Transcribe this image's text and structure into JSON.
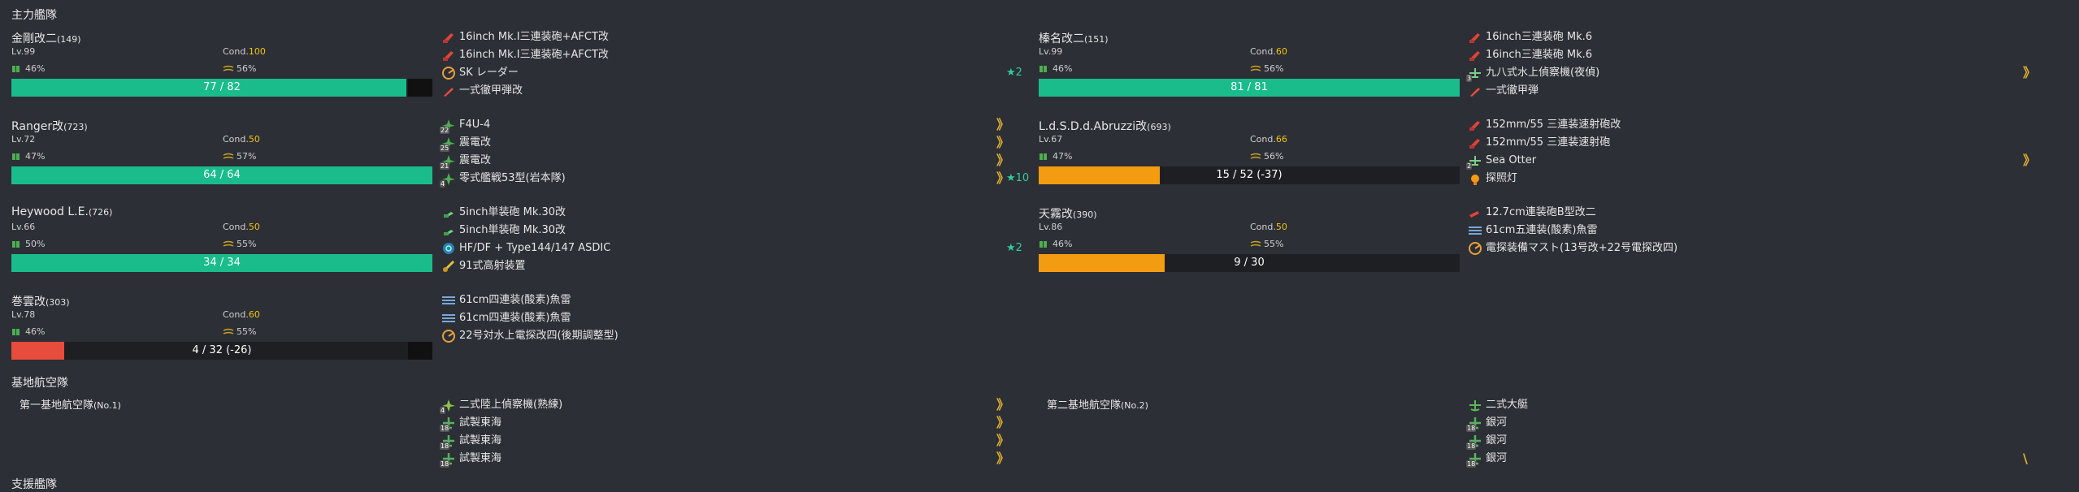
{
  "sections": {
    "main_fleet": "主力艦隊",
    "base_air": "基地航空隊",
    "support": "支援艦隊"
  },
  "colors": {
    "hp_green": "#1abc8c",
    "hp_orange": "#f39c12",
    "hp_red": "#e74c3c",
    "cond_yellow": "#f1c40f",
    "star": "#2ecc9a"
  },
  "ships": [
    {
      "name": "金剛改二",
      "id": "(149)",
      "lv": "Lv.99",
      "cond_label": "Cond.",
      "cond": "100",
      "fuel": "46%",
      "ammo": "56%",
      "hp": "77 / 82",
      "hp_frac": 0.939,
      "hp_color": "green",
      "equips": [
        {
          "icon": "gun-red-icon",
          "name": "16inch Mk.I三連装砲+AFCT改"
        },
        {
          "icon": "gun-red-icon",
          "name": "16inch Mk.I三連装砲+AFCT改"
        },
        {
          "icon": "radar-icon",
          "name": "SK レーダー",
          "star": "★2"
        },
        {
          "icon": "shell-icon",
          "name": "一式徹甲弾改"
        }
      ]
    },
    {
      "name": "榛名改二",
      "id": "(151)",
      "lv": "Lv.99",
      "cond_label": "Cond.",
      "cond": "60",
      "fuel": "46%",
      "ammo": "56%",
      "hp": "81 / 81",
      "hp_frac": 1.0,
      "hp_color": "green",
      "equips": [
        {
          "icon": "gun-red-icon",
          "name": "16inch三連装砲 Mk.6"
        },
        {
          "icon": "gun-red-icon",
          "name": "16inch三連装砲 Mk.6"
        },
        {
          "icon": "seaplane-icon",
          "name": "九八式水上偵察機(夜偵)",
          "prof": "3",
          "chev": "》"
        },
        {
          "icon": "shell-icon",
          "name": "一式徹甲弾"
        }
      ]
    },
    {
      "name": "Ranger改",
      "id": "(723)",
      "lv": "Lv.72",
      "cond_label": "Cond.",
      "cond": "50",
      "fuel": "47%",
      "ammo": "57%",
      "hp": "64 / 64",
      "hp_frac": 1.0,
      "hp_color": "green",
      "equips": [
        {
          "icon": "fighter-icon",
          "name": "F4U-4",
          "prof": "22",
          "chev": "》"
        },
        {
          "icon": "fighter-icon",
          "name": "震電改",
          "prof": "25",
          "chev": "》"
        },
        {
          "icon": "fighter-icon",
          "name": "震電改",
          "prof": "21",
          "chev": "》"
        },
        {
          "icon": "fighter-icon",
          "name": "零式艦戦53型(岩本隊)",
          "prof": "4",
          "chev": "》",
          "star": "★10"
        }
      ]
    },
    {
      "name": "L.d.S.D.d.Abruzzi改",
      "id": "(693)",
      "lv": "Lv.67",
      "cond_label": "Cond.",
      "cond": "66",
      "fuel": "47%",
      "ammo": "56%",
      "hp": "15 / 52 (-37)",
      "hp_frac": 0.288,
      "hp_color": "orange",
      "equips": [
        {
          "icon": "gun-red-icon",
          "name": "152mm/55 三連装速射砲改"
        },
        {
          "icon": "gun-red-icon",
          "name": "152mm/55 三連装速射砲"
        },
        {
          "icon": "seaplane-icon",
          "name": "Sea Otter",
          "prof": "2",
          "chev": "》"
        },
        {
          "icon": "searchlight-icon",
          "name": "探照灯"
        }
      ]
    },
    {
      "name": "Heywood L.E.",
      "id": "(726)",
      "lv": "Lv.66",
      "cond_label": "Cond.",
      "cond": "50",
      "fuel": "50%",
      "ammo": "55%",
      "hp": "34 / 34",
      "hp_frac": 1.0,
      "hp_color": "green",
      "equips": [
        {
          "icon": "gun-green-icon",
          "name": "5inch単装砲 Mk.30改"
        },
        {
          "icon": "gun-green-icon",
          "name": "5inch単装砲 Mk.30改"
        },
        {
          "icon": "sonar-icon",
          "name": "HF/DF + Type144/147 ASDIC",
          "star": "★2"
        },
        {
          "icon": "aa-gun-icon",
          "name": "91式高射装置"
        }
      ]
    },
    {
      "name": "天霧改",
      "id": "(390)",
      "lv": "Lv.86",
      "cond_label": "Cond.",
      "cond": "50",
      "fuel": "46%",
      "ammo": "55%",
      "hp": "9 / 30",
      "hp_frac": 0.3,
      "hp_color": "orange",
      "equips": [
        {
          "icon": "gun-red-small-icon",
          "name": "12.7cm連装砲B型改二"
        },
        {
          "icon": "torpedo-icon",
          "name": "61cm五連装(酸素)魚雷"
        },
        {
          "icon": "radar-icon",
          "name": "電探装備マスト(13号改+22号電探改四)"
        }
      ]
    },
    {
      "name": "巻雲改",
      "id": "(303)",
      "lv": "Lv.78",
      "cond_label": "Cond.",
      "cond": "60",
      "fuel": "46%",
      "ammo": "55%",
      "hp": "4 / 32 (-26)",
      "hp_frac": 0.125,
      "hp_color": "red",
      "equips": [
        {
          "icon": "torpedo-icon",
          "name": "61cm四連装(酸素)魚雷"
        },
        {
          "icon": "torpedo-icon",
          "name": "61cm四連装(酸素)魚雷"
        },
        {
          "icon": "radar-icon",
          "name": "22号対水上電探改四(後期調整型)"
        }
      ]
    }
  ],
  "air_bases": [
    {
      "name": "第一基地航空隊",
      "id": "(No.1)",
      "equips": [
        {
          "icon": "recon-plane-icon",
          "name": "二式陸上偵察機(熟練)",
          "prof": "4",
          "chev": "》"
        },
        {
          "icon": "land-bomber-icon",
          "name": "試製東海",
          "prof": "18",
          "chev": "》"
        },
        {
          "icon": "land-bomber-icon",
          "name": "試製東海",
          "prof": "18",
          "chev": "》"
        },
        {
          "icon": "land-bomber-icon",
          "name": "試製東海",
          "prof": "18",
          "chev": "》"
        }
      ]
    },
    {
      "name": "第二基地航空隊",
      "id": "(No.2)",
      "equips": [
        {
          "icon": "flying-boat-icon",
          "name": "二式大艇"
        },
        {
          "icon": "land-bomber-icon",
          "name": "銀河",
          "prof": "18"
        },
        {
          "icon": "land-bomber-icon",
          "name": "銀河",
          "prof": "18"
        },
        {
          "icon": "land-bomber-icon",
          "name": "銀河",
          "prof": "18",
          "chev": "\\"
        }
      ]
    }
  ]
}
